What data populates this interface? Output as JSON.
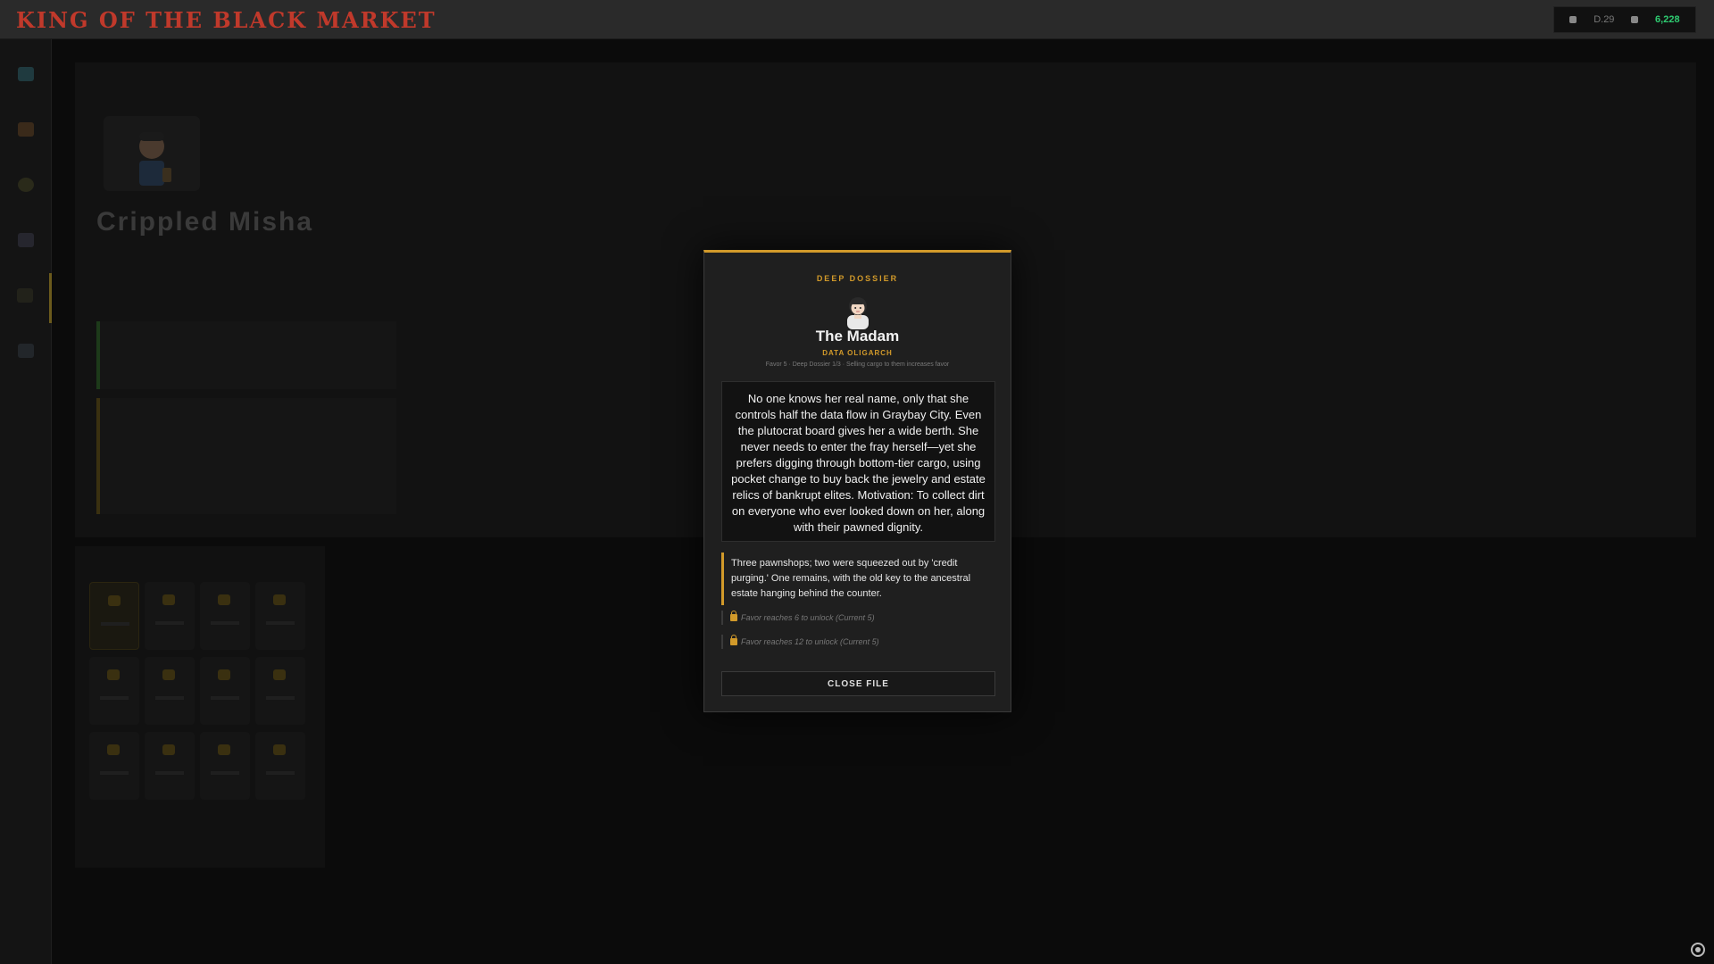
{
  "app": {
    "title": "KING OF THE BLACK MARKET",
    "stats": {
      "cash": "6,228",
      "day": "D.29"
    }
  },
  "sidebar": {
    "items": [
      {
        "id": "market",
        "icon": "map-icon",
        "color": "#1f3a3f"
      },
      {
        "id": "inventory",
        "icon": "bag-icon",
        "color": "#3a2a1a"
      },
      {
        "id": "gear",
        "icon": "gear-icon",
        "color": "#2a2a1a"
      },
      {
        "id": "mail",
        "icon": "mail-icon",
        "color": "#26262e"
      },
      {
        "id": "contacts",
        "icon": "person-icon",
        "color": "#22221a",
        "active": true
      },
      {
        "id": "log",
        "icon": "book-icon",
        "color": "#22262a"
      }
    ]
  },
  "background": {
    "character_name": "Crippled Misha"
  },
  "modal": {
    "kicker": "DEEP DOSSIER",
    "avatar_icon": "woman-avatar-icon",
    "name": "The Madam",
    "role": "DATA OLIGARCH",
    "meta": "Favor 5 · Deep Dossier 1/3 · Selling cargo to them increases favor",
    "bio": "No one knows her real name, only that she controls half the data flow in Graybay City. Even the plutocrat board gives her a wide berth. She never needs to enter the fray herself—yet she prefers digging through bottom-tier cargo, using pocket change to buy back the jewelry and estate relics of bankrupt elites. Motivation: To collect dirt on everyone who ever looked down on her, along with their pawned dignity.",
    "clue": "Three pawnshops; two were squeezed out by 'credit purging.' One remains, with the old key to the ancestral estate hanging behind the counter.",
    "locked": [
      "Favor reaches 6 to unlock (Current 5)",
      "Favor reaches 12 to unlock (Current 5)"
    ],
    "close_label": "CLOSE FILE"
  },
  "colors": {
    "accent": "#d29a2a",
    "danger": "#c0392b",
    "cash": "#2ecc71"
  }
}
